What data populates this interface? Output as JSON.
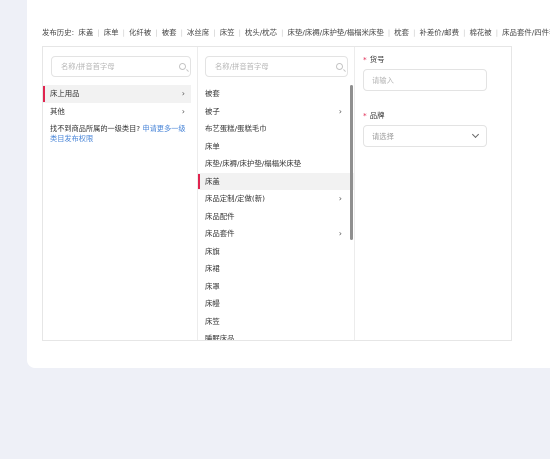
{
  "history": {
    "label": "发布历史:",
    "items": [
      "床盖",
      "床单",
      "化纤被",
      "被套",
      "冰丝席",
      "床笠",
      "枕头/枕芯",
      "床垫/床褥/床护垫/榻榻米床垫",
      "枕套",
      "补差价/邮费",
      "棉花被",
      "床品套件/四件套/多件套"
    ]
  },
  "level1": {
    "search_placeholder": "名称/拼音首字母",
    "items": [
      {
        "label": "床上用品",
        "has_children": true,
        "active": true
      },
      {
        "label": "其他",
        "has_children": true,
        "active": false
      }
    ],
    "hint_text": "找不到商品所属的一级类目?",
    "hint_link": "申请更多一级类目发布权限"
  },
  "level2": {
    "search_placeholder": "名称/拼音首字母",
    "items": [
      {
        "label": "被套",
        "has_children": false,
        "active": false
      },
      {
        "label": "被子",
        "has_children": true,
        "active": false
      },
      {
        "label": "布艺蛋糕/蛋糕毛巾",
        "has_children": false,
        "active": false
      },
      {
        "label": "床单",
        "has_children": false,
        "active": false
      },
      {
        "label": "床垫/床褥/床护垫/榻榻米床垫",
        "has_children": false,
        "active": false
      },
      {
        "label": "床盖",
        "has_children": false,
        "active": true
      },
      {
        "label": "床品定制/定做(新)",
        "has_children": true,
        "active": false
      },
      {
        "label": "床品配件",
        "has_children": false,
        "active": false
      },
      {
        "label": "床品套件",
        "has_children": true,
        "active": false
      },
      {
        "label": "床旗",
        "has_children": false,
        "active": false
      },
      {
        "label": "床裙",
        "has_children": false,
        "active": false
      },
      {
        "label": "床罩",
        "has_children": false,
        "active": false
      },
      {
        "label": "床幔",
        "has_children": false,
        "active": false
      },
      {
        "label": "床笠",
        "has_children": false,
        "active": false
      },
      {
        "label": "睡眠床品",
        "has_children": false,
        "active": false
      }
    ]
  },
  "form": {
    "item_no": {
      "label": "货号",
      "placeholder": "请输入"
    },
    "brand": {
      "label": "品牌",
      "placeholder": "请选择"
    },
    "required_mark": "*"
  },
  "icons": {
    "search": "search-icon",
    "chevron_right": "›",
    "dropdown": "chevron-down-icon"
  },
  "colors": {
    "accent": "#e0244f",
    "link": "#4a86d8",
    "background": "#eef0f7"
  }
}
